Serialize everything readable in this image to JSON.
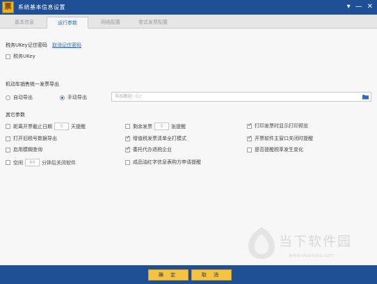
{
  "window": {
    "logo_char": "票",
    "title": "系统基本信息设置",
    "controls": {
      "menu": "▾",
      "minimize": "—",
      "close": "✕"
    }
  },
  "tabs": [
    {
      "label": "基本信息",
      "active": false
    },
    {
      "label": "运行参数",
      "active": true
    },
    {
      "label": "网络配置",
      "active": false
    },
    {
      "label": "卷式发票配置",
      "active": false
    }
  ],
  "ukey_section": {
    "title": "税务UKey记住密码",
    "cancel_link": "取消记住密码",
    "checkbox_label": "税务UKey",
    "checked": false
  },
  "export_section": {
    "title": "机动车销售统一发票导出",
    "auto_export": {
      "label": "自动导出",
      "checked": false
    },
    "manual_export": {
      "label": "手动导出",
      "checked": true
    },
    "path_placeholder": "导出路径：C:/"
  },
  "other_section": {
    "title": "其它参数",
    "deadline": {
      "prefix": "距离开票截止日期",
      "value": "5",
      "suffix": "天提醒",
      "checked": false
    },
    "remaining": {
      "prefix": "剩余发票",
      "value": "5",
      "suffix": "张提醒",
      "checked": false
    },
    "print_preview": {
      "label": "打印发票时显示打印预览",
      "checked": true
    },
    "old_tax_export": {
      "label": "打开旧税号数据导出",
      "checked": false
    },
    "vat_list_print": {
      "label": "增值税发票清单全打模式",
      "checked": true
    },
    "main_window_close": {
      "label": "开票软件主窗口关闭时提醒",
      "checked": true
    },
    "fuzzy_query": {
      "label": "启用模糊查询",
      "checked": false
    },
    "entrusted_return": {
      "label": "委托代办退税企业",
      "checked": true
    },
    "tax_rate_change": {
      "label": "是否提醒税率发生变化",
      "checked": false
    },
    "idle_close": {
      "prefix": "空闲",
      "value": "60",
      "suffix": "分钟后关闭软件",
      "checked": false
    },
    "red_letter_remind": {
      "label": "成品油红字信息表购方申请提醒",
      "checked": false
    }
  },
  "buttons": {
    "confirm": "确 定",
    "cancel": "取 消"
  },
  "watermark": {
    "title": "当下软件园",
    "url": "www.downxia.com"
  },
  "colors": {
    "header": "#1f4f94",
    "button": "#f5c342",
    "link": "#2a6dc4"
  }
}
